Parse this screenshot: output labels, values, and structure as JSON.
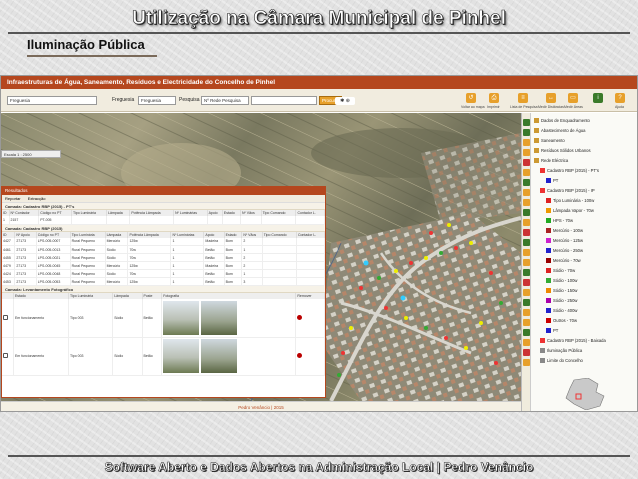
{
  "slide": {
    "title": "Utilização na Câmara Municipal de Pinhel",
    "subtitle": "Iluminação Pública",
    "footer": "Software Aberto e Dados Abertos na Administração Local   |   Pedro Venâncio"
  },
  "app": {
    "header": "Infraestruturas de Água, Saneamento, Resíduos e Electricidade do Concelho de Pinhel",
    "toolbar": {
      "select1": "Freguesia",
      "label2": "Freguesia",
      "select2": "Freguesia",
      "label3": "Pesquisa",
      "select3": "Nº Rede Pesquisa",
      "search_btn": "Procurar",
      "icons": [
        "Voltar ao mapa",
        "Imprimir",
        "Lista de Pesquisa",
        "Medir Distâncias",
        "Medir Áreas",
        "Ajuda"
      ]
    },
    "scale": "Escala 1 : 2500",
    "status": "Pedro Venâncio | 2015",
    "layers": [
      {
        "label": "Dados de Enquadramento",
        "color": "#c93"
      },
      {
        "label": "Abastecimento de Água",
        "color": "#c93"
      },
      {
        "label": "Saneamento",
        "color": "#c93"
      },
      {
        "label": "Resíduos Sólidos Urbanos",
        "color": "#c93"
      },
      {
        "label": "Rede Eléctrica",
        "color": "#c93"
      },
      {
        "label": "Cadastro RBP (2015) - PT's",
        "color": "#e33"
      },
      {
        "label": "PT",
        "color": "#22c"
      },
      {
        "label": "Cadastro RBP (2015) - IP",
        "color": "#e33"
      },
      {
        "label": "Tipo Luminária - 100w",
        "color": "#d22"
      },
      {
        "label": "Lâmpada Vapor - 70w",
        "color": "#e90"
      },
      {
        "label": "HPS - 70w",
        "color": "#2a2"
      },
      {
        "label": "Mercúrio - 100w",
        "color": "#a22"
      },
      {
        "label": "Mercúrio - 125w",
        "color": "#c2c"
      },
      {
        "label": "Mercúrio - 250w",
        "color": "#22c"
      },
      {
        "label": "Mercúrio - 70w",
        "color": "#900"
      },
      {
        "label": "Sódio - 70w",
        "color": "#d22"
      },
      {
        "label": "Sódio - 100w",
        "color": "#3a3"
      },
      {
        "label": "Sódio - 150w",
        "color": "#e80"
      },
      {
        "label": "Sódio - 250w",
        "color": "#a0a"
      },
      {
        "label": "Sódio - 400w",
        "color": "#22c"
      },
      {
        "label": "Outros - 70w",
        "color": "#c00"
      },
      {
        "label": "PT",
        "color": "#22c"
      },
      {
        "label": "Cadastro RBP (2015) - Baixada",
        "color": "#e33"
      },
      {
        "label": "Iluminação Pública",
        "color": "#888"
      },
      {
        "label": "Limite do Concelho",
        "color": "#888"
      }
    ]
  },
  "dialog": {
    "title": "Resultados",
    "tabs": [
      "Reportar",
      "Extracção"
    ],
    "section1": "Camada: Cadastro RBP (2015) - PT's",
    "headers1": [
      "ID",
      "Nº Contador",
      "Código no PT",
      "Tipo Luminária",
      "Lâmpada",
      "Potência Lâmpada",
      "Nº Luminárias",
      "Apoio",
      "Estado",
      "Nº Vãos",
      "Tipo Comando",
      "Contador L."
    ],
    "rows1": [
      [
        "1",
        "2157",
        "PT-005",
        "",
        "",
        "",
        "",
        "",
        "",
        "",
        "",
        ""
      ]
    ],
    "section2": "Camada: Cadastro RBP (2015)",
    "headers2": [
      "ID",
      "Nº Apoio",
      "Código no PT",
      "Tipo Luminária",
      "Lâmpada",
      "Potência Lâmpada",
      "Nº Luminárias",
      "Apoio",
      "Estado",
      "Nº Vãos",
      "Tipo Comando",
      "Contador L."
    ],
    "rows2": [
      [
        "4427",
        "27173",
        "LPS-005-0007",
        "Rural Pequeno",
        "Mercúrio",
        "125w",
        "1",
        "Madeira",
        "Bom",
        "2",
        "",
        ""
      ],
      [
        "4461",
        "27173",
        "LPS-005-0013",
        "Rural Pequeno",
        "Sódio",
        "70w",
        "1",
        "Betão",
        "Bom",
        "1",
        "",
        ""
      ],
      [
        "4455",
        "27173",
        "LPS-005-0021",
        "Rural Pequeno",
        "Sódio",
        "70w",
        "1",
        "Betão",
        "Bom",
        "2",
        "",
        ""
      ],
      [
        "4479",
        "27173",
        "LPS-005-0045",
        "Rural Pequeno",
        "Mercúrio",
        "125w",
        "1",
        "Madeira",
        "Bom",
        "2",
        "",
        ""
      ],
      [
        "4424",
        "27173",
        "LPS-005-0048",
        "Rural Pequeno",
        "Sódio",
        "70w",
        "1",
        "Betão",
        "Bom",
        "1",
        "",
        ""
      ],
      [
        "4453",
        "27173",
        "LPS-005-0053",
        "Rural Pequeno",
        "Mercúrio",
        "125w",
        "1",
        "Betão",
        "Bom",
        "3",
        "",
        ""
      ]
    ],
    "section3": "Camada: Levantamento Fotográfico",
    "headers3": [
      "",
      "Estado",
      "Tipo Luminária",
      "Lâmpada",
      "Poste",
      "Fotografia",
      "Remover"
    ],
    "rows3": [
      [
        "",
        "Em funcionamento",
        "Tipo 003",
        "Sódio",
        "Betão",
        "",
        ""
      ],
      [
        "",
        "Em funcionamento",
        "Tipo 003",
        "Sódio",
        "Betão",
        "",
        ""
      ]
    ]
  }
}
